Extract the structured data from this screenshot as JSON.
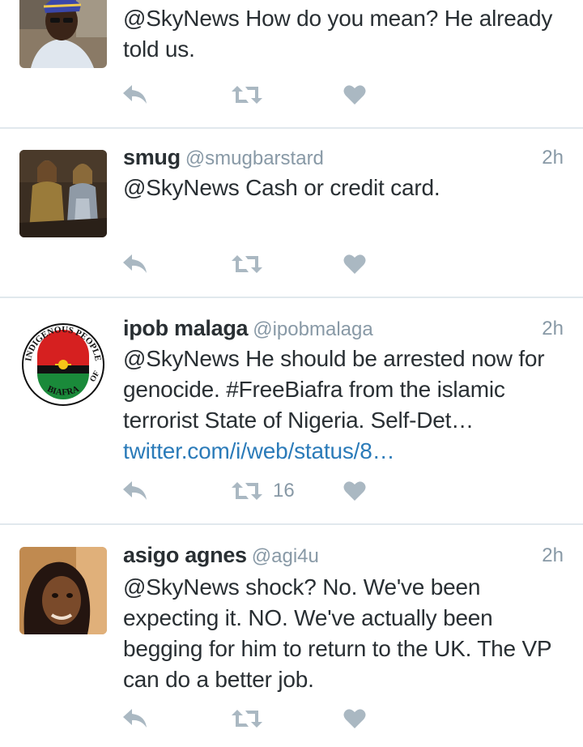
{
  "tweets": [
    {
      "name": "",
      "handle": "",
      "time": "",
      "lines": [
        "@SkyNews How do you mean? He already",
        "told us."
      ],
      "link": "",
      "retweet_count": ""
    },
    {
      "name": "smug",
      "handle": "@smugbarstard",
      "time": "2h",
      "lines": [
        "@SkyNews Cash or credit card."
      ],
      "link": "",
      "retweet_count": ""
    },
    {
      "name": "ipob malaga",
      "handle": "@ipobmalaga",
      "time": "2h",
      "lines": [
        "@SkyNews He should be arrested now for",
        "genocide. #FreeBiafra  from the islamic",
        "terrorist State of Nigeria. Self-Det…"
      ],
      "link": "twitter.com/i/web/status/8…",
      "retweet_count": "16",
      "avatar_text_top": "INDIGENOUS PEOPLE",
      "avatar_text_bottom": "BIAFRA",
      "avatar_text_right": "OF"
    },
    {
      "name": "asigo agnes",
      "handle": "@agi4u",
      "time": "2h",
      "lines": [
        "@SkyNews shock? No. We've been",
        "expecting it. NO. We've actually been",
        "begging for him to return to the UK.  The VP",
        "can do a better job."
      ],
      "link": "",
      "retweet_count": ""
    }
  ],
  "icons": {
    "reply": "reply-icon",
    "retweet": "retweet-icon",
    "like": "heart-icon"
  },
  "colors": {
    "text": "#292f33",
    "muted": "#8899a6",
    "link": "#2b7bb9",
    "action_icon": "#aab8c2",
    "divider": "#e1e8ed"
  }
}
